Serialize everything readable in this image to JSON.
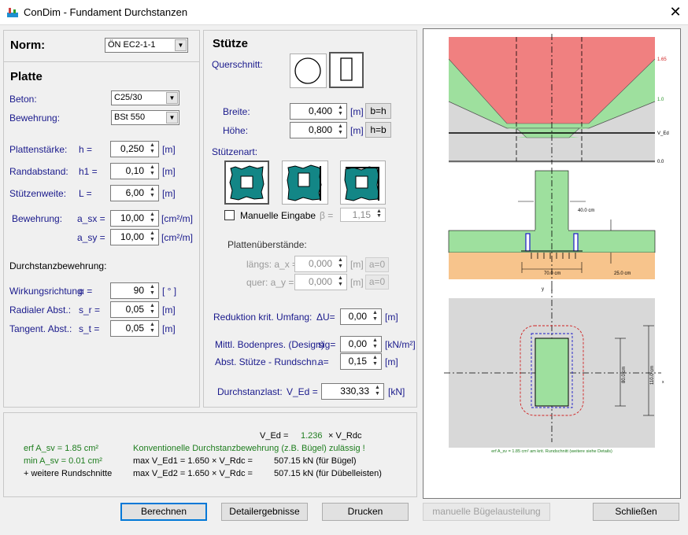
{
  "window": {
    "title": "ConDim - Fundament Durchstanzen"
  },
  "norm": {
    "label": "Norm:",
    "value": "ÖN EC2-1-1"
  },
  "platte": {
    "header": "Platte",
    "beton_label": "Beton:",
    "beton_value": "C25/30",
    "bewehrung_label": "Bewehrung:",
    "bewehrung_value": "BSt 550",
    "rows": [
      {
        "label": "Plattenstärke:",
        "sym": "h =",
        "value": "0,250",
        "unit": "[m]"
      },
      {
        "label": "Randabstand:",
        "sym": "h1 =",
        "value": "0,10",
        "unit": "[m]"
      },
      {
        "label": "Stützenweite:",
        "sym": "L =",
        "value": "6,00",
        "unit": "[m]"
      }
    ],
    "bew_label": "Bewehrung:",
    "asx_sym": "a_sx =",
    "asx_value": "10,00",
    "asx_unit": "[cm²/m]",
    "asy_sym": "a_sy =",
    "asy_value": "10,00",
    "asy_unit": "[cm²/m]",
    "durch_label": "Durchstanzbewehrung:",
    "durch_rows": [
      {
        "label": "Wirkungsrichtung",
        "sym": "α =",
        "value": "90",
        "unit": "[ ° ]"
      },
      {
        "label": "Radialer Abst.:",
        "sym": "s_r =",
        "value": "0,05",
        "unit": "[m]"
      },
      {
        "label": "Tangent. Abst.:",
        "sym": "s_t =",
        "value": "0,05",
        "unit": "[m]"
      }
    ]
  },
  "stuetze": {
    "header": "Stütze",
    "querschnitt_label": "Querschnitt:",
    "breite_label": "Breite:",
    "breite_value": "0,400",
    "breite_unit": "[m]",
    "bh_btn": "b=h",
    "hoehe_label": "Höhe:",
    "hoehe_value": "0,800",
    "hoehe_unit": "[m]",
    "hb_btn": "h=b",
    "art_label": "Stützenart:",
    "manuelle_label": "Manuelle Eingabe",
    "beta_label": "β =",
    "beta_value": "1,15",
    "ueberstand_label": "Plattenüberstände:",
    "laengs_label": "längs:  a_x =",
    "laengs_value": "0,000",
    "laengs_unit": "[m]",
    "ax_btn": "a=0",
    "quer_label": "quer:   a_y =",
    "quer_value": "0,000",
    "quer_unit": "[m]",
    "ay_btn": "a=0",
    "red_label": "Reduktion krit. Umfang:",
    "red_sym": "ΔU=",
    "red_value": "0,00",
    "red_unit": "[m]",
    "boden_label": "Mittl. Bodenpres. (Design)",
    "boden_sym": "sig=",
    "boden_value": "0,00",
    "boden_unit": "[kN/m²]",
    "abst_label": "Abst. Stütze - Rundschn.",
    "abst_sym": "a=",
    "abst_value": "0,15",
    "abst_unit": "[m]",
    "last_label": "Durchstanzlast:",
    "last_sym": "V_Ed =",
    "last_value": "330,33",
    "last_unit": "[kN]"
  },
  "results": {
    "ved_line_a": "V_Ed =",
    "ved_factor": "1.236",
    "ved_line_b": "× V_Rdc",
    "erf": "erf A_sv =   1.85 cm²",
    "min": "min A_sv =  0.01 cm²",
    "weitere": "+ weitere Rundschnitte",
    "konv": "Konventionelle Durchstanzbewehrung (z.B. Bügel) zulässig !",
    "max1": "max V_Ed1 = 1.650 × V_Rdc =",
    "max1_val": "507.15 kN (für Bügel)",
    "max2": "max V_Ed2 = 1.650 × V_Rdc =",
    "max2_val": "507.15 kN (für Dübelleisten)"
  },
  "buttons": {
    "berechnen": "Berechnen",
    "detail": "Detailergebnisse",
    "drucken": "Drucken",
    "manuelle": "manuelle Bügelausteilung",
    "schliessen": "Schließen"
  },
  "drawing": {
    "lbl_165": "1.65",
    "lbl_10": "1.0",
    "lbl_ved": "V_Ed",
    "lbl_00": "0.0",
    "dim_40": "40.0 cm",
    "dim_70": "70.0 cm",
    "dim_25": "25.0 cm",
    "dim_80": "80.0 cm",
    "dim_110": "110.0 cm",
    "axis_y": "y",
    "axis_x": "x",
    "caption": "erf A_sv = 1.85 cm² am krit. Rundschnitt (weitere siehe Details)",
    "colors": {
      "red": "#f08080",
      "green": "#9ee09e",
      "grey": "#d8d8d8",
      "soil": "#f7c48c"
    }
  }
}
